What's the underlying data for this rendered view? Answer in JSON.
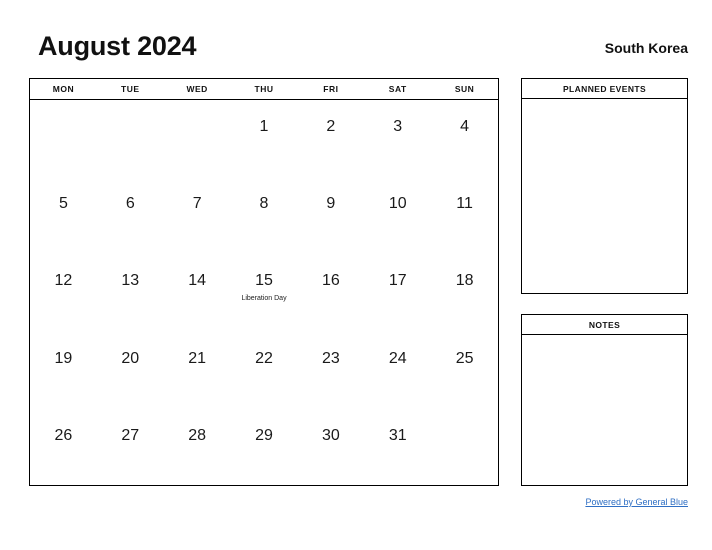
{
  "header": {
    "title": "August 2024",
    "region": "South Korea"
  },
  "calendar": {
    "weekday_headers": [
      "MON",
      "TUE",
      "WED",
      "THU",
      "FRI",
      "SAT",
      "SUN"
    ],
    "weeks": [
      [
        {
          "day": "",
          "event": ""
        },
        {
          "day": "",
          "event": ""
        },
        {
          "day": "",
          "event": ""
        },
        {
          "day": "1",
          "event": ""
        },
        {
          "day": "2",
          "event": ""
        },
        {
          "day": "3",
          "event": ""
        },
        {
          "day": "4",
          "event": ""
        }
      ],
      [
        {
          "day": "5",
          "event": ""
        },
        {
          "day": "6",
          "event": ""
        },
        {
          "day": "7",
          "event": ""
        },
        {
          "day": "8",
          "event": ""
        },
        {
          "day": "9",
          "event": ""
        },
        {
          "day": "10",
          "event": ""
        },
        {
          "day": "11",
          "event": ""
        }
      ],
      [
        {
          "day": "12",
          "event": ""
        },
        {
          "day": "13",
          "event": ""
        },
        {
          "day": "14",
          "event": ""
        },
        {
          "day": "15",
          "event": "Liberation Day"
        },
        {
          "day": "16",
          "event": ""
        },
        {
          "day": "17",
          "event": ""
        },
        {
          "day": "18",
          "event": ""
        }
      ],
      [
        {
          "day": "19",
          "event": ""
        },
        {
          "day": "20",
          "event": ""
        },
        {
          "day": "21",
          "event": ""
        },
        {
          "day": "22",
          "event": ""
        },
        {
          "day": "23",
          "event": ""
        },
        {
          "day": "24",
          "event": ""
        },
        {
          "day": "25",
          "event": ""
        }
      ],
      [
        {
          "day": "26",
          "event": ""
        },
        {
          "day": "27",
          "event": ""
        },
        {
          "day": "28",
          "event": ""
        },
        {
          "day": "29",
          "event": ""
        },
        {
          "day": "30",
          "event": ""
        },
        {
          "day": "31",
          "event": ""
        },
        {
          "day": "",
          "event": ""
        }
      ]
    ]
  },
  "panels": {
    "planned_events": {
      "title": "PLANNED EVENTS",
      "content": ""
    },
    "notes": {
      "title": "NOTES",
      "content": ""
    }
  },
  "footer": {
    "link_label": "Powered by General Blue",
    "link_color": "#2f6fc4"
  }
}
